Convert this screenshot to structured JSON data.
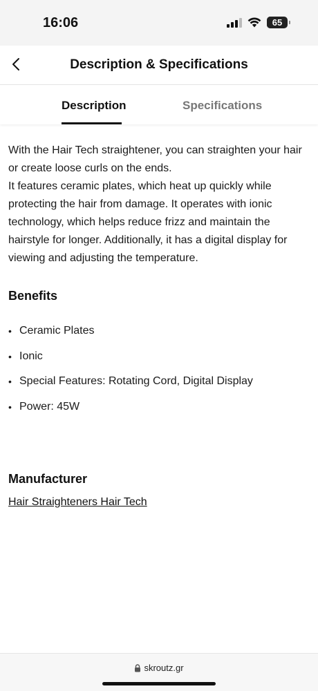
{
  "status_bar": {
    "time": "16:06",
    "battery": "65",
    "battery_level": 0.65,
    "icons": [
      "signal-icon",
      "wifi-icon",
      "battery-icon"
    ]
  },
  "header": {
    "title": "Description & Specifications",
    "back_icon": "chevron-left-icon"
  },
  "tabs": [
    {
      "label": "Description",
      "active": true
    },
    {
      "label": "Specifications",
      "active": false
    }
  ],
  "description": {
    "paragraphs": [
      "With the Hair Tech straightener, you can straighten your hair or create loose curls on the ends.",
      "It features ceramic plates, which heat up quickly while protecting the hair from damage. It operates with ionic technology, which helps reduce frizz and maintain the hairstyle for longer. Additionally, it has a digital display for viewing and adjusting the temperature."
    ]
  },
  "benefits": {
    "title": "Benefits",
    "bullet": "•",
    "items": [
      "Ceramic Plates",
      "Ionic",
      "Special Features: Rotating Cord, Digital Display",
      "Power: 45W"
    ]
  },
  "manufacturer": {
    "title": "Manufacturer",
    "link": "Hair Straighteners Hair Tech"
  },
  "browser": {
    "url": "skroutz.gr",
    "lock_icon": "lock-icon"
  },
  "colors": {
    "text": "#111111",
    "inactive_tab": "#777777",
    "background": "#ffffff"
  }
}
